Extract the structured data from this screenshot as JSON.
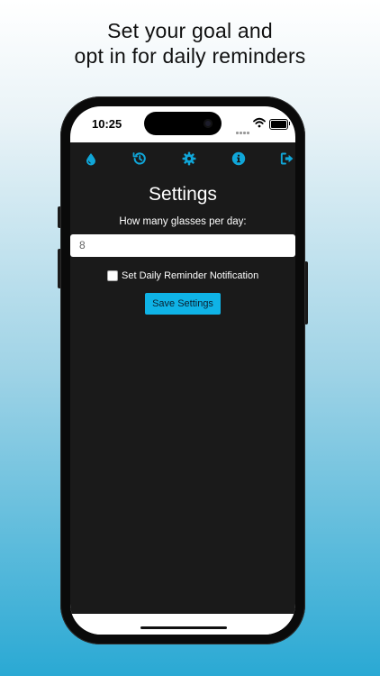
{
  "headline": {
    "line1": "Set your goal and",
    "line2": "opt in for daily reminders"
  },
  "status_bar": {
    "time": "10:25"
  },
  "nav": {
    "icons": [
      "water-drop-icon",
      "history-icon",
      "gear-icon",
      "info-icon",
      "logout-icon"
    ],
    "accent": "#10a6d8"
  },
  "settings": {
    "title": "Settings",
    "glasses_label": "How many glasses per day:",
    "glasses_value": "8",
    "reminder_label": "Set Daily Reminder Notification",
    "reminder_checked": false,
    "save_label": "Save Settings"
  },
  "colors": {
    "app_background": "#1a1a1a",
    "button": "#0fb3e6"
  }
}
